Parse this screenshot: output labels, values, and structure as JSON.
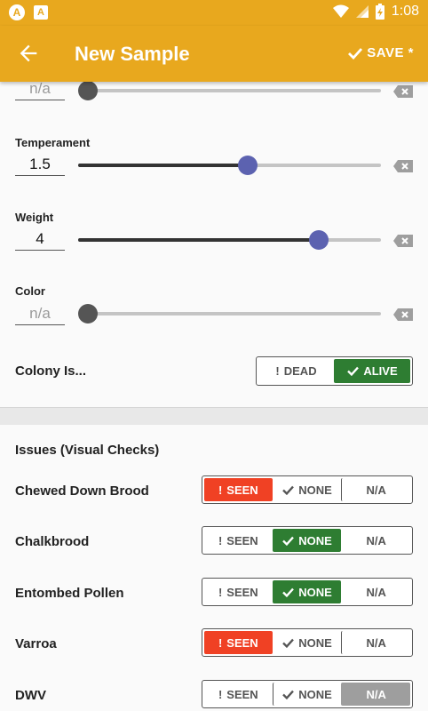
{
  "status_bar": {
    "time": "1:08",
    "left_icons": [
      "app-notification-icon",
      "accessibility-icon"
    ],
    "right_icons": [
      "wifi-icon",
      "cell-signal-icon",
      "battery-charging-icon"
    ]
  },
  "app_bar": {
    "title": "New Sample",
    "save_label": "SAVE *",
    "back_icon": "arrow-back-icon",
    "save_icon": "check-icon",
    "color": "#e8a81e"
  },
  "sliders": [
    {
      "label": "",
      "value": "n/a",
      "is_na": true,
      "fraction": 0.0
    },
    {
      "label": "Temperament",
      "value": "1.5",
      "is_na": false,
      "fraction": 0.555
    },
    {
      "label": "Weight",
      "value": "4",
      "is_na": false,
      "fraction": 0.79
    },
    {
      "label": "Color",
      "value": "n/a",
      "is_na": true,
      "fraction": 0.0
    }
  ],
  "colony": {
    "label": "Colony Is...",
    "options": [
      "DEAD",
      "ALIVE"
    ],
    "selected": "ALIVE"
  },
  "issues": {
    "title": "Issues (Visual Checks)",
    "options": [
      "SEEN",
      "NONE",
      "N/A"
    ],
    "rows": [
      {
        "label": "Chewed Down Brood",
        "selected": "SEEN"
      },
      {
        "label": "Chalkbrood",
        "selected": "NONE"
      },
      {
        "label": "Entombed Pollen",
        "selected": "NONE"
      },
      {
        "label": "Varroa",
        "selected": "SEEN"
      },
      {
        "label": "DWV",
        "selected": "N/A"
      }
    ]
  },
  "colors": {
    "accent_slider": "#5c62b0",
    "selected_green": "#2e7d32",
    "selected_red": "#f04124",
    "selected_gray": "#9e9e9e"
  }
}
